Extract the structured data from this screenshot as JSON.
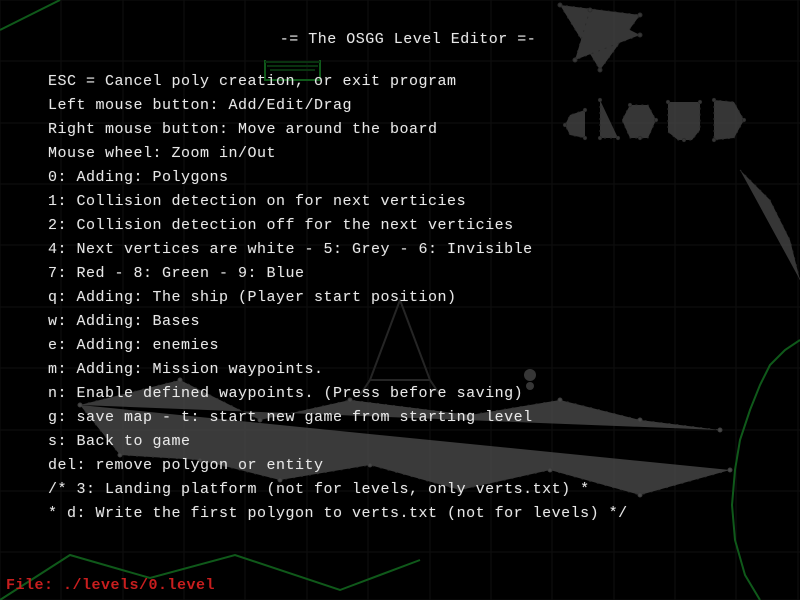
{
  "title": "-= The OSGG Level Editor =-",
  "help_lines": [
    "ESC = Cancel poly creation, or exit program",
    "Left mouse button: Add/Edit/Drag",
    "Right mouse button: Move around the board",
    "Mouse wheel: Zoom in/Out",
    "0: Adding: Polygons",
    "1: Collision detection on for next verticies",
    "2: Collision detection off for the next verticies",
    "4: Next vertices are white - 5: Grey - 6: Invisible",
    "7: Red - 8: Green - 9: Blue",
    "q: Adding: The ship (Player start position)",
    "w: Adding: Bases",
    "e: Adding: enemies",
    "m: Adding: Mission waypoints.",
    "n: Enable defined waypoints. (Press before saving)",
    "g: save map - t: start new game from starting level",
    "s: Back to game",
    "del: remove polygon or entity",
    "/* 3: Landing platform (not for levels, only verts.txt)     *",
    " * d: Write the first polygon to verts.txt (not for levels) */"
  ],
  "status": {
    "label": "File: ",
    "path": "./levels/0.level"
  },
  "colors": {
    "bg": "#000000",
    "text": "#e8e8e8",
    "grid": "#2b2b2b",
    "green": "#2dff4a",
    "dim_green": "#2a6b34",
    "white_dot": "#bfbfbf",
    "file": "#c81e1e"
  }
}
